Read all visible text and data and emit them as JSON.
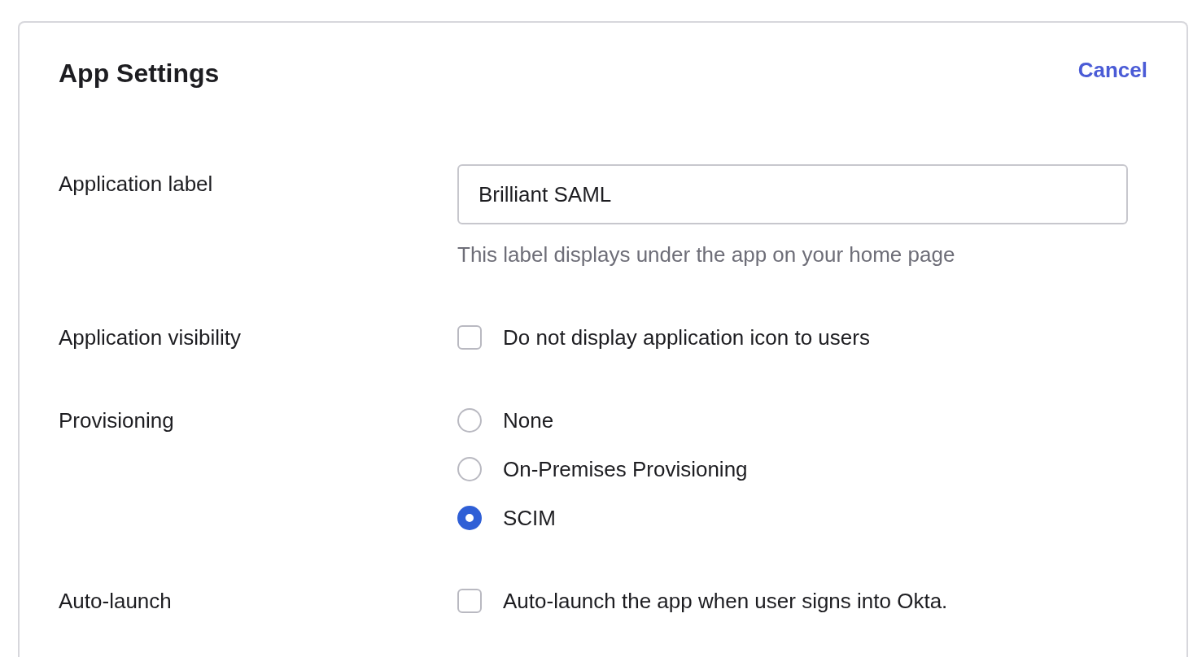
{
  "header": {
    "title": "App Settings",
    "cancel": "Cancel"
  },
  "fields": [
    {
      "kind": "text",
      "label": "Application label",
      "value": "Brilliant SAML",
      "hint": "This label displays under the app on your home page"
    },
    {
      "kind": "checkbox",
      "label": "Application visibility",
      "options": [
        {
          "label": "Do not display application icon to users",
          "checked": false
        }
      ]
    },
    {
      "kind": "radio",
      "label": "Provisioning",
      "options": [
        {
          "label": "None",
          "selected": false
        },
        {
          "label": "On-Premises Provisioning",
          "selected": false
        },
        {
          "label": "SCIM",
          "selected": true
        }
      ]
    },
    {
      "kind": "checkbox",
      "label": "Auto-launch",
      "options": [
        {
          "label": "Auto-launch the app when user signs into Okta.",
          "checked": false
        }
      ]
    }
  ]
}
